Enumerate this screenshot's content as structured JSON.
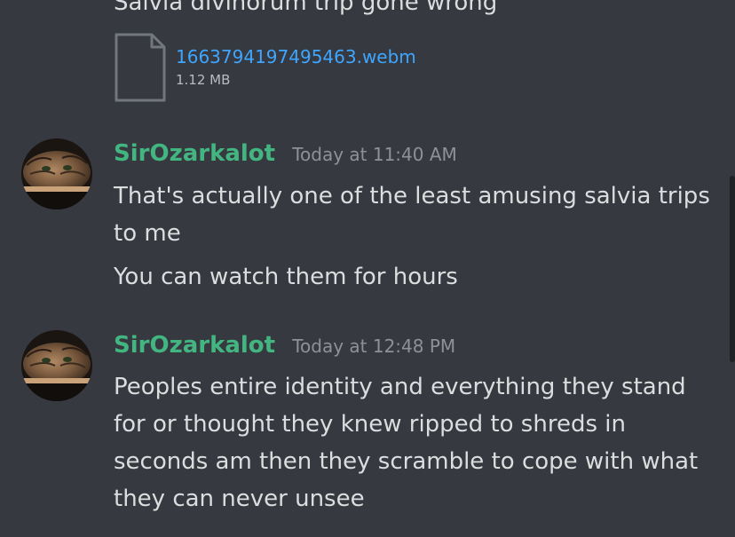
{
  "previous_message": {
    "text": "Salvia divinorum trip gone wrong",
    "attachment": {
      "file_name": "1663794197495463.webm",
      "file_size": "1.12 MB",
      "icon": "file-icon"
    }
  },
  "messages": [
    {
      "username": "SirOzarkalot",
      "timestamp": "Today at 11:40 AM",
      "avatar_icon": "cat-avatar",
      "lines": [
        "That's actually one of the least amusing salvia trips to me",
        "You can watch them for hours"
      ]
    },
    {
      "username": "SirOzarkalot",
      "timestamp": "Today at 12:48 PM",
      "avatar_icon": "cat-avatar",
      "lines": [
        "Peoples entire identity and everything they stand for or thought they knew ripped to shreds in seconds am then they scramble to cope with what they can never unsee"
      ]
    }
  ],
  "colors": {
    "background": "#36393f",
    "username": "#43b581",
    "link": "#3ea6ff",
    "text": "#dcddde",
    "timestamp": "#8e9297"
  }
}
